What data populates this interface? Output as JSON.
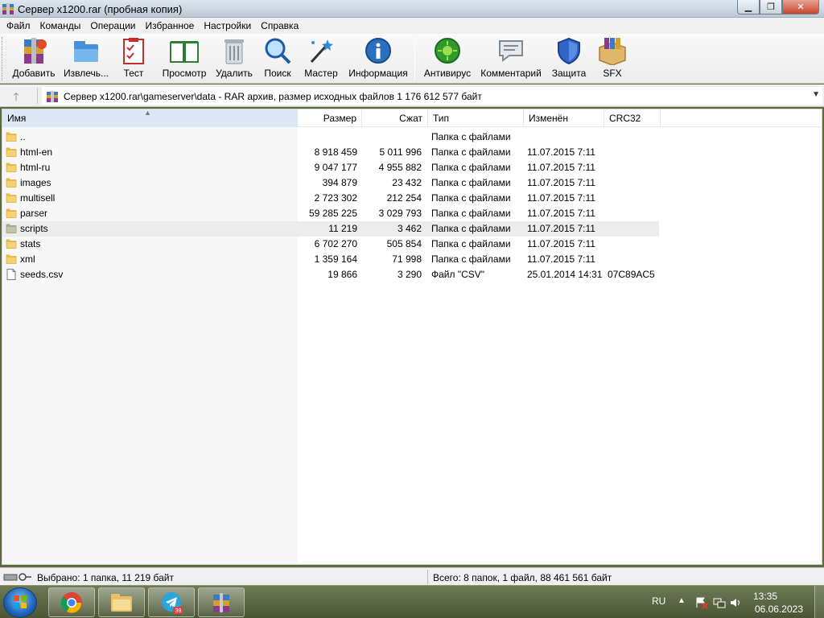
{
  "window": {
    "title": "Сервер x1200.rar (пробная копия)"
  },
  "menu": [
    "Файл",
    "Команды",
    "Операции",
    "Избранное",
    "Настройки",
    "Справка"
  ],
  "toolbar": [
    {
      "label": "Добавить",
      "icon": "add-icon"
    },
    {
      "label": "Извлечь...",
      "icon": "extract-icon"
    },
    {
      "label": "Тест",
      "icon": "test-icon"
    },
    {
      "label": "Просмотр",
      "icon": "view-icon"
    },
    {
      "label": "Удалить",
      "icon": "delete-icon"
    },
    {
      "label": "Поиск",
      "icon": "find-icon"
    },
    {
      "label": "Мастер",
      "icon": "wizard-icon"
    },
    {
      "label": "Информация",
      "icon": "info-icon"
    },
    {
      "label": "Антивирус",
      "icon": "antivirus-icon"
    },
    {
      "label": "Комментарий",
      "icon": "comment-icon"
    },
    {
      "label": "Защита",
      "icon": "protect-icon"
    },
    {
      "label": "SFX",
      "icon": "sfx-icon"
    }
  ],
  "address": {
    "path": "Сервер x1200.rar\\gameserver\\data - RAR архив, размер исходных файлов 1 176 612 577 байт"
  },
  "columns": {
    "name": "Имя",
    "size": "Размер",
    "packed": "Сжат",
    "type": "Тип",
    "modified": "Изменён",
    "crc": "CRC32"
  },
  "files": [
    {
      "name": "..",
      "size": "",
      "packed": "",
      "type": "Папка с файлами",
      "modified": "",
      "crc": "",
      "kind": "folder"
    },
    {
      "name": "html-en",
      "size": "8 918 459",
      "packed": "5 011 996",
      "type": "Папка с файлами",
      "modified": "11.07.2015 7:11",
      "crc": "",
      "kind": "folder"
    },
    {
      "name": "html-ru",
      "size": "9 047 177",
      "packed": "4 955 882",
      "type": "Папка с файлами",
      "modified": "11.07.2015 7:11",
      "crc": "",
      "kind": "folder"
    },
    {
      "name": "images",
      "size": "394 879",
      "packed": "23 432",
      "type": "Папка с файлами",
      "modified": "11.07.2015 7:11",
      "crc": "",
      "kind": "folder"
    },
    {
      "name": "multisell",
      "size": "2 723 302",
      "packed": "212 254",
      "type": "Папка с файлами",
      "modified": "11.07.2015 7:11",
      "crc": "",
      "kind": "folder"
    },
    {
      "name": "parser",
      "size": "59 285 225",
      "packed": "3 029 793",
      "type": "Папка с файлами",
      "modified": "11.07.2015 7:11",
      "crc": "",
      "kind": "folder"
    },
    {
      "name": "scripts",
      "size": "11 219",
      "packed": "3 462",
      "type": "Папка с файлами",
      "modified": "11.07.2015 7:11",
      "crc": "",
      "kind": "folder",
      "selected": true
    },
    {
      "name": "stats",
      "size": "6 702 270",
      "packed": "505 854",
      "type": "Папка с файлами",
      "modified": "11.07.2015 7:11",
      "crc": "",
      "kind": "folder"
    },
    {
      "name": "xml",
      "size": "1 359 164",
      "packed": "71 998",
      "type": "Папка с файлами",
      "modified": "11.07.2015 7:11",
      "crc": "",
      "kind": "folder"
    },
    {
      "name": "seeds.csv",
      "size": "19 866",
      "packed": "3 290",
      "type": "Файл \"CSV\"",
      "modified": "25.01.2014 14:31",
      "crc": "07C89AC5",
      "kind": "file"
    }
  ],
  "status": {
    "left": "Выбрано: 1 папка, 11 219 байт",
    "right": "Всего: 8 папок, 1 файл, 88 461 561 байт"
  },
  "taskbar": {
    "apps": [
      {
        "name": "chrome",
        "icon": "chrome-icon"
      },
      {
        "name": "explorer",
        "icon": "folder-icon"
      },
      {
        "name": "telegram",
        "icon": "telegram-icon",
        "badge": "39"
      },
      {
        "name": "winrar",
        "icon": "winrar-icon"
      }
    ],
    "lang": "RU",
    "time": "13:35",
    "date": "06.06.2023"
  },
  "colors": {
    "folder": "#e8b84a",
    "selection": "#ececec",
    "sorted_header": "#dbe9f6"
  }
}
